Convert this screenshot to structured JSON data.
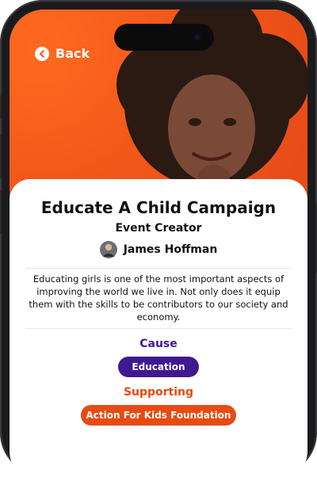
{
  "app": {
    "back_label": "Back",
    "event": {
      "title": "Educate A Child Campaign",
      "role_label": "Event Creator",
      "creator_name": "James Hoffman",
      "description": "Educating girls is one of the most important aspects of improving the world we live in. Not only does it equip them with the skills to be contributors to our society and economy."
    },
    "cause": {
      "label": "Cause",
      "value": "Education"
    },
    "supporting": {
      "label": "Supporting",
      "value": "Action For Kids Foundation"
    }
  },
  "colors": {
    "accent_orange": "#f2571a",
    "cause_purple": "#3f1a8f",
    "pill_orange": "#e84a12",
    "text_dark": "#111111"
  },
  "icons": {
    "back": "chevron-left-circle-icon",
    "avatar": "user-avatar-icon"
  }
}
